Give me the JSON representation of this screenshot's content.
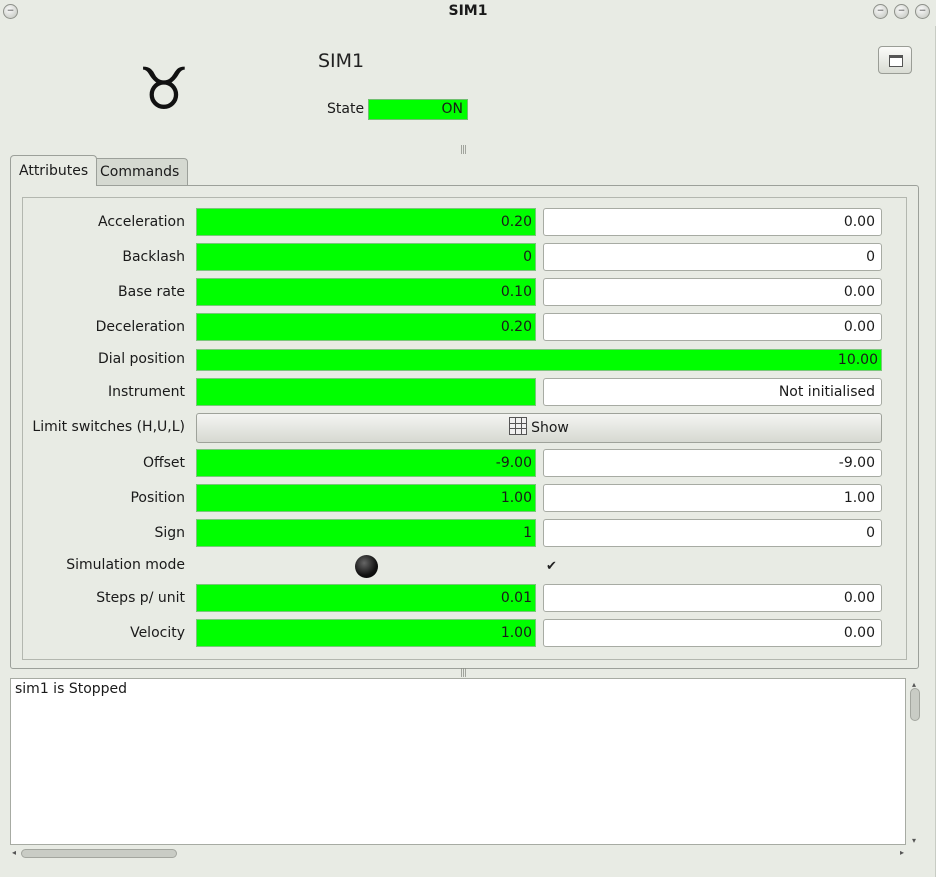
{
  "window": {
    "title": "SIM1",
    "controls": [
      "minimize-icon",
      "maximize-icon",
      "close-icon"
    ]
  },
  "header": {
    "logo_glyph": "♉",
    "device_name": "SIM1",
    "state_label": "State",
    "state_value": "ON",
    "state_color": "#00ff00"
  },
  "tabs": [
    {
      "label": "Attributes",
      "active": true
    },
    {
      "label": "Commands",
      "active": false
    }
  ],
  "attributes": {
    "acceleration": {
      "label": "Acceleration",
      "read": "0.20",
      "write": "0.00"
    },
    "backlash": {
      "label": "Backlash",
      "read": "0",
      "write": "0"
    },
    "base_rate": {
      "label": "Base rate",
      "read": "0.10",
      "write": "0.00"
    },
    "deceleration": {
      "label": "Deceleration",
      "read": "0.20",
      "write": "0.00"
    },
    "dial_position": {
      "label": "Dial position",
      "read": "10.00"
    },
    "instrument": {
      "label": "Instrument",
      "read": "",
      "write": "Not initialised"
    },
    "limit_switches": {
      "label": "Limit switches (H,U,L)",
      "button": "Show"
    },
    "offset": {
      "label": "Offset",
      "read": "-9.00",
      "write": "-9.00"
    },
    "position": {
      "label": "Position",
      "read": "1.00",
      "write": "1.00"
    },
    "sign": {
      "label": "Sign",
      "read": "1",
      "write": "0"
    },
    "simulation_mode": {
      "label": "Simulation mode",
      "led": "off",
      "checked": true,
      "check_glyph": "✔"
    },
    "steps_per_unit": {
      "label": "Steps p/ unit",
      "read": "0.01",
      "write": "0.00"
    },
    "velocity": {
      "label": "Velocity",
      "read": "1.00",
      "write": "0.00"
    }
  },
  "log": {
    "text": "sim1 is Stopped"
  },
  "colors": {
    "valid_read": "#00ff00",
    "background": "#e8ebe4"
  }
}
